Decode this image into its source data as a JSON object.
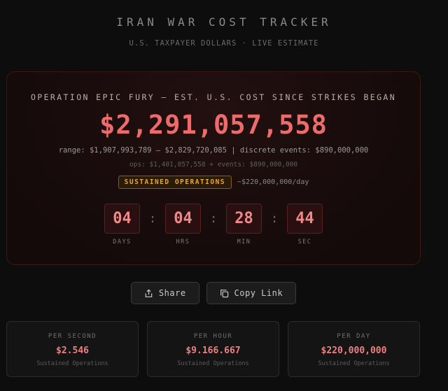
{
  "header": {
    "title": "IRAN WAR COST TRACKER",
    "subtitle": "U.S. TAXPAYER DOLLARS · LIVE ESTIMATE"
  },
  "main": {
    "label": "OPERATION EPIC FURY — EST. U.S. COST SINCE STRIKES BEGAN",
    "total": "$2,291,057,558",
    "range": "range: $1,907,993,789 – $2,829,720,085 | discrete events: $890,000,000",
    "ops": "ops: $1,401,057,558 + events: $890,000,000",
    "status_badge": "SUSTAINED OPERATIONS",
    "rate": "~$220,000,000/day",
    "timer": [
      {
        "value": "04",
        "label": "DAYS"
      },
      {
        "value": "04",
        "label": "HRS"
      },
      {
        "value": "28",
        "label": "MIN"
      },
      {
        "value": "44",
        "label": "SEC"
      }
    ],
    "timer_separator": ":"
  },
  "actions": {
    "share_label": "Share",
    "copy_label": "Copy Link",
    "share_icon": "share-icon",
    "copy_icon": "copy-icon"
  },
  "stats": [
    {
      "label": "PER SECOND",
      "value": "$2.546",
      "caption": "Sustained Operations"
    },
    {
      "label": "PER HOUR",
      "value": "$9.166.667",
      "caption": "Sustained Operations"
    },
    {
      "label": "PER DAY",
      "value": "$220,000,000",
      "caption": "Sustained Operations"
    }
  ],
  "colors": {
    "background": "#0d0d0d",
    "accent": "#ee6b6b",
    "badge": "#e8a838"
  }
}
